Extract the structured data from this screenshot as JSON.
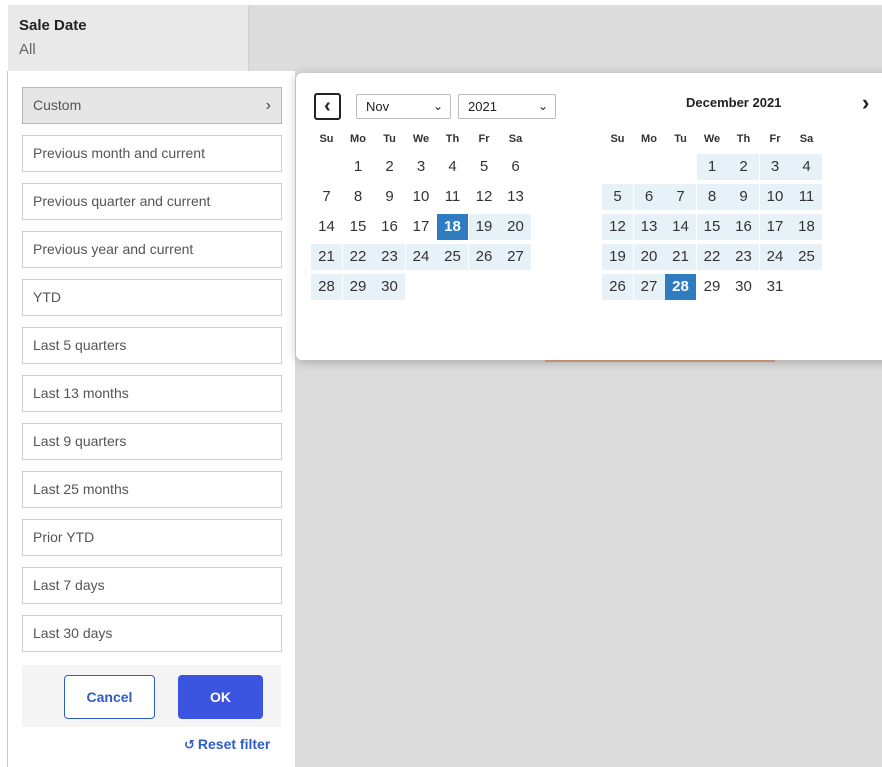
{
  "header": {
    "title": "Sale Date",
    "value": "All"
  },
  "presets": [
    "Custom",
    "Previous month and current",
    "Previous quarter and current",
    "Previous year and current",
    "YTD",
    "Last 5 quarters",
    "Last 13 months",
    "Last 9 quarters",
    "Last 25 months",
    "Prior YTD",
    "Last 7 days",
    "Last 30 days"
  ],
  "buttons": {
    "cancel": "Cancel",
    "ok": "OK",
    "reset": "Reset filter"
  },
  "icons": {
    "prev": "‹",
    "next": "›",
    "chevron": "›",
    "reset": "↺",
    "dropdown": "⌄"
  },
  "calendar": {
    "month_select": "Nov",
    "year_select": "2021",
    "right_title": "December 2021",
    "weekdays": [
      "Su",
      "Mo",
      "Tu",
      "We",
      "Th",
      "Fr",
      "Sa"
    ],
    "left_weeks": [
      [
        "",
        "1",
        "2",
        "3",
        "4",
        "5",
        "6"
      ],
      [
        "7",
        "8",
        "9",
        "10",
        "11",
        "12",
        "13"
      ],
      [
        "14",
        "15",
        "16",
        "17",
        "18",
        "19",
        "20"
      ],
      [
        "21",
        "22",
        "23",
        "24",
        "25",
        "26",
        "27"
      ],
      [
        "28",
        "29",
        "30",
        "",
        "",
        "",
        ""
      ]
    ],
    "right_weeks": [
      [
        "",
        "",
        "",
        "1",
        "2",
        "3",
        "4"
      ],
      [
        "5",
        "6",
        "7",
        "8",
        "9",
        "10",
        "11"
      ],
      [
        "12",
        "13",
        "14",
        "15",
        "16",
        "17",
        "18"
      ],
      [
        "19",
        "20",
        "21",
        "22",
        "23",
        "24",
        "25"
      ],
      [
        "26",
        "27",
        "28",
        "29",
        "30",
        "31",
        ""
      ]
    ],
    "range_start": "2021-11-18",
    "range_end": "2021-12-28"
  },
  "colors": {
    "accent": "#3c55e0",
    "selected_day": "#2f7cc1",
    "range_fill": "#e7f1f8"
  }
}
